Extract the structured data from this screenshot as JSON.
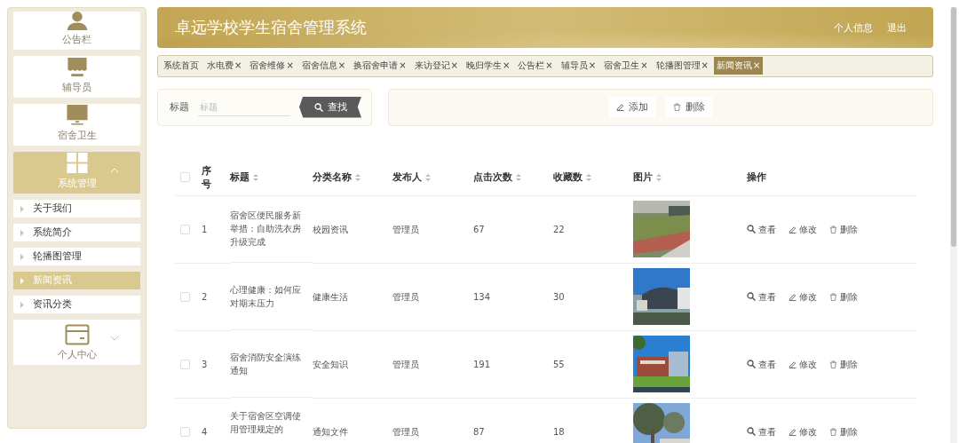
{
  "sidebar": {
    "items": [
      {
        "label": "公告栏",
        "selected": false
      },
      {
        "label": "辅导员",
        "selected": false
      },
      {
        "label": "宿舍卫生",
        "selected": false
      },
      {
        "label": "系统管理",
        "selected": true,
        "expanded": true,
        "children": [
          {
            "label": "关于我们",
            "selected": false
          },
          {
            "label": "系统简介",
            "selected": false
          },
          {
            "label": "轮播图管理",
            "selected": false
          },
          {
            "label": "新闻资讯",
            "selected": true
          },
          {
            "label": "资讯分类",
            "selected": false
          }
        ]
      },
      {
        "label": "个人中心",
        "selected": false,
        "expanded": false
      }
    ]
  },
  "header": {
    "title": "卓远学校学生宿舍管理系统",
    "links": [
      "个人信息",
      "退出"
    ]
  },
  "tabs": [
    {
      "label": "系统首页",
      "selected": false
    },
    {
      "label": "水电费",
      "close": "×",
      "selected": false
    },
    {
      "label": "宿舍维修",
      "close": "×",
      "selected": false
    },
    {
      "label": "宿舍信息",
      "close": "×",
      "selected": false
    },
    {
      "label": "换宿舍申请",
      "close": "×",
      "selected": false
    },
    {
      "label": "来访登记",
      "close": "×",
      "selected": false
    },
    {
      "label": "晚归学生",
      "close": "×",
      "selected": false
    },
    {
      "label": "公告栏",
      "close": "×",
      "selected": false
    },
    {
      "label": "辅导员",
      "close": "×",
      "selected": false
    },
    {
      "label": "宿舍卫生",
      "close": "×",
      "selected": false
    },
    {
      "label": "轮播图管理",
      "close": "×",
      "selected": false
    },
    {
      "label": "新闻资讯",
      "close": "×",
      "selected": true
    }
  ],
  "search": {
    "label": "标题",
    "placeholder": "标题",
    "button": "查找"
  },
  "actions": [
    "添加",
    "删除"
  ],
  "table": {
    "columns": [
      {
        "label": "序号",
        "sortable": false
      },
      {
        "label": "标题",
        "sortable": true
      },
      {
        "label": "分类名称",
        "sortable": true
      },
      {
        "label": "发布人",
        "sortable": true
      },
      {
        "label": "点击次数",
        "sortable": true
      },
      {
        "label": "收藏数",
        "sortable": true
      },
      {
        "label": "图片",
        "sortable": true
      },
      {
        "label": "操作",
        "sortable": false
      }
    ],
    "header_checked": false,
    "rows": [
      {
        "checked": false,
        "cells": [
          "1",
          "宿舍区便民服务新举措：自助洗衣房升级完成",
          "校园资讯",
          "管理员",
          "67",
          "22"
        ],
        "actions": [
          "查看",
          "修改",
          "删除"
        ]
      },
      {
        "checked": false,
        "cells": [
          "2",
          "心理健康：如何应对期末压力",
          "健康生活",
          "管理员",
          "134",
          "30"
        ],
        "actions": [
          "查看",
          "修改",
          "删除"
        ]
      },
      {
        "checked": false,
        "cells": [
          "3",
          "宿舍消防安全演练通知",
          "安全知识",
          "管理员",
          "191",
          "55"
        ],
        "actions": [
          "查看",
          "修改",
          "删除"
        ]
      },
      {
        "checked": false,
        "cells": [
          "4",
          "关于宿舍区空调使用管理规定的",
          "通知文件",
          "管理员",
          "87",
          "18"
        ],
        "actions": [
          "查看",
          "修改",
          "删除"
        ]
      }
    ]
  }
}
